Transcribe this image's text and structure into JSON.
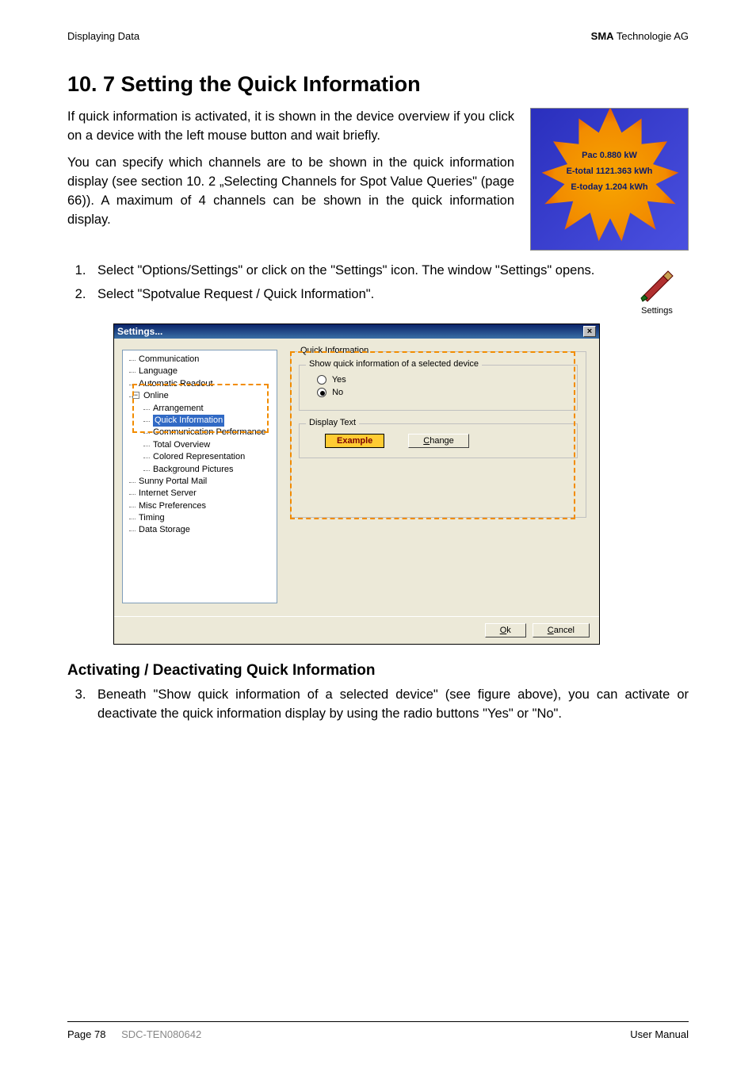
{
  "header": {
    "left": "Displaying Data",
    "right_bold": "SMA",
    "right_rest": " Technologie AG"
  },
  "title": "10. 7 Setting the Quick Information",
  "intro": {
    "p1": "If quick information is activated, it is shown in the device overview if you click on a device with the left mouse button and wait briefly.",
    "p2": "You can specify which channels are to be shown in the quick information display (see section 10. 2 „Selecting Channels for Spot Value Queries\" (page 66)). A maximum of 4 channels can be shown in the quick information display."
  },
  "quickinfo_img": {
    "line1": "Pac 0.880 kW",
    "line2": "E-total 1121.363 kWh",
    "line3": "E-today 1.204 kWh"
  },
  "steps": {
    "s1": "Select \"Options/Settings\" or click on the \"Settings\" icon. The window \"Settings\" opens.",
    "s2": "Select \"Spotvalue Request / Quick Information\"."
  },
  "settings_icon_label": "Settings",
  "dialog": {
    "title": "Settings...",
    "tree": {
      "communication": "Communication",
      "language": "Language",
      "automatic_readout": "Automatic Readout",
      "online": "Online",
      "arrangement": "Arrangement",
      "quick_information": "Quick Information",
      "communication_performance": "Communication Performance",
      "total_overview": "Total Overview",
      "colored_representation": "Colored Representation",
      "background_pictures": "Background Pictures",
      "sunny_portal_mail": "Sunny Portal Mail",
      "internet_server": "Internet Server",
      "misc_preferences": "Misc Preferences",
      "timing": "Timing",
      "data_storage": "Data Storage"
    },
    "group_qi": "Quick Information",
    "group_show": "Show quick information of a selected device",
    "radio_yes": "Yes",
    "radio_no": "No",
    "group_display": "Display Text",
    "example": "Example",
    "change": "Change",
    "ok": "Ok",
    "cancel": "Cancel"
  },
  "subheading": "Activating / Deactivating Quick Information",
  "step3": "Beneath \"Show quick information of a selected device\" (see figure above), you can activate or deactivate the quick information display by using the radio buttons \"Yes\" or \"No\".",
  "footer": {
    "page": "Page 78",
    "docid": "SDC-TEN080642",
    "right": "User Manual"
  }
}
